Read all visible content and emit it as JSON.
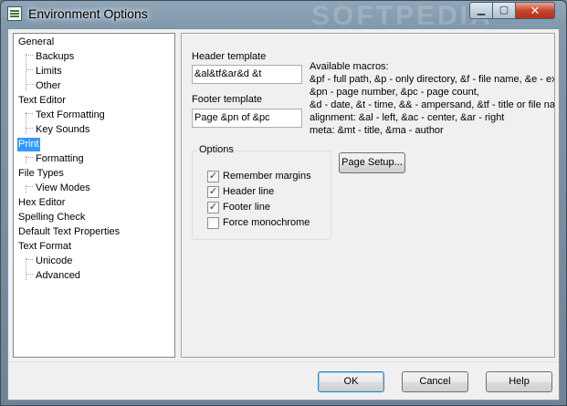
{
  "window": {
    "title": "Environment Options",
    "watermark": "SOFTPEDIA",
    "minimize_glyph": "▁",
    "maximize_glyph": "▢",
    "close_glyph": "✕",
    "app_icon": "document-icon"
  },
  "tree": {
    "items": [
      {
        "label": "General",
        "level": 0
      },
      {
        "label": "Backups",
        "level": 1
      },
      {
        "label": "Limits",
        "level": 1
      },
      {
        "label": "Other",
        "level": 1
      },
      {
        "label": "Text Editor",
        "level": 0
      },
      {
        "label": "Text Formatting",
        "level": 1
      },
      {
        "label": "Key Sounds",
        "level": 1
      },
      {
        "label": "Print",
        "level": 0,
        "selected": true
      },
      {
        "label": "Formatting",
        "level": 1
      },
      {
        "label": "File Types",
        "level": 0
      },
      {
        "label": "View Modes",
        "level": 1
      },
      {
        "label": "Hex Editor",
        "level": 0
      },
      {
        "label": "Spelling Check",
        "level": 0
      },
      {
        "label": "Default Text Properties",
        "level": 0
      },
      {
        "label": "Text Format",
        "level": 0
      },
      {
        "label": "Unicode",
        "level": 1
      },
      {
        "label": "Advanced",
        "level": 1
      }
    ]
  },
  "print": {
    "header_label": "Header template",
    "header_value": "&al&tf&ar&d &t",
    "footer_label": "Footer template",
    "footer_value": "Page &pn of &pc",
    "macros_title": "Available macros:",
    "macros_lines": [
      "&pf - full path, &p - only directory, &f - file name, &e - ex",
      "&pn - page number, &pc - page count,",
      "&d - date, &t - time, && - ampersand, &tf - title or file na",
      "alignment: &al - left, &ac - center, &ar - right",
      "meta: &mt - title, &ma - author"
    ],
    "options_title": "Options",
    "options": [
      {
        "label": "Remember margins",
        "checked": true
      },
      {
        "label": "Header line",
        "checked": true
      },
      {
        "label": "Footer line",
        "checked": true
      },
      {
        "label": "Force monochrome",
        "checked": false
      }
    ],
    "page_setup_label": "Page Setup..."
  },
  "buttons": {
    "ok": "OK",
    "cancel": "Cancel",
    "help": "Help"
  },
  "colors": {
    "selection": "#3399ff",
    "titlebar": "#7f98ad",
    "close_button": "#c8452c"
  }
}
